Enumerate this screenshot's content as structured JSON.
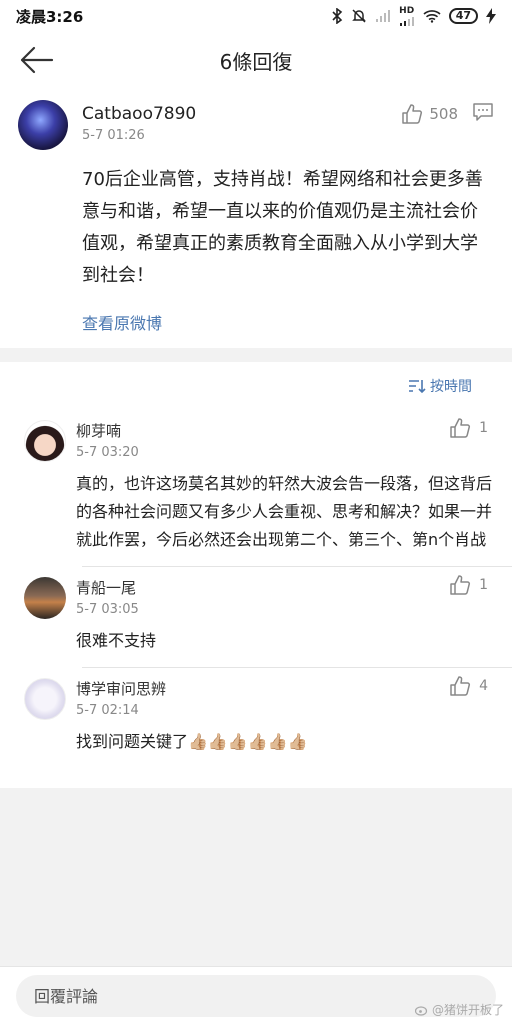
{
  "status_bar": {
    "time": "凌晨3:26",
    "battery": "47",
    "signal_label": "HD"
  },
  "header": {
    "title": "6條回復"
  },
  "post": {
    "username": "Catbaoo7890",
    "time": "5-7 01:26",
    "likes": "508",
    "content": "70后企业高管，支持肖战！希望网络和社会更多善意与和谐，希望一直以来的价值观仍是主流社会价值观，希望真正的素质教育全面融入从小学到大学到社会！",
    "view_original": "查看原微博"
  },
  "sort": {
    "label": "按時間"
  },
  "replies": [
    {
      "name": "柳芽喃",
      "time": "5-7 03:20",
      "likes": "1",
      "content": "真的，也许这场莫名其妙的轩然大波会告一段落，但这背后的各种社会问题又有多少人会重视、思考和解决？如果一并就此作罢，今后必然还会出现第二个、第三个、第n个肖战"
    },
    {
      "name": "青船一尾",
      "time": "5-7 03:05",
      "likes": "1",
      "content": "很难不支持"
    },
    {
      "name": "博学审问思辨",
      "time": "5-7 02:14",
      "likes": "4",
      "content": "找到问题关键了👍🏼👍🏼👍🏼👍🏼👍🏼👍🏼"
    }
  ],
  "bottom": {
    "input_placeholder": "回覆評論",
    "watermark": "@猪饼开板了"
  },
  "colors": {
    "link": "#4a77b0",
    "background": "#f2f2f2"
  },
  "icons": {
    "back": "arrow-left-icon",
    "like": "thumbs-up-icon",
    "comment": "comment-icon",
    "sort": "sort-icon"
  }
}
